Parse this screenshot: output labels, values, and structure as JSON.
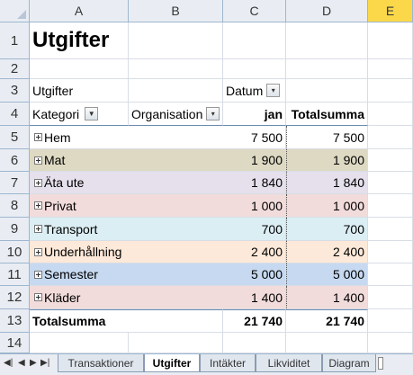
{
  "columns": [
    "A",
    "B",
    "C",
    "D",
    "E"
  ],
  "rows": [
    "1",
    "2",
    "3",
    "4",
    "5",
    "6",
    "7",
    "8",
    "9",
    "10",
    "11",
    "12",
    "13",
    "14"
  ],
  "title": "Utgifter",
  "pivot": {
    "filter_label": "Utgifter",
    "col_field": "Datum",
    "header_kategori": "Kategori",
    "header_org": "Organisation",
    "header_jan": "jan",
    "header_total": "Totalsumma",
    "items": [
      {
        "label": "Hem",
        "jan": "7 500",
        "total": "7 500",
        "color": "#ffffff"
      },
      {
        "label": "Mat",
        "jan": "1 900",
        "total": "1 900",
        "color": "#ddd9c3"
      },
      {
        "label": "Äta ute",
        "jan": "1 840",
        "total": "1 840",
        "color": "#e5e0ec"
      },
      {
        "label": "Privat",
        "jan": "1 000",
        "total": "1 000",
        "color": "#f2dcdb"
      },
      {
        "label": "Transport",
        "jan": "700",
        "total": "700",
        "color": "#dbeef3"
      },
      {
        "label": "Underhållning",
        "jan": "2 400",
        "total": "2 400",
        "color": "#fde9d9"
      },
      {
        "label": "Semester",
        "jan": "5 000",
        "total": "5 000",
        "color": "#c6d9f0"
      },
      {
        "label": "Kläder",
        "jan": "1 400",
        "total": "1 400",
        "color": "#f2dcdb"
      }
    ],
    "grand_label": "Totalsumma",
    "grand_jan": "21 740",
    "grand_total": "21 740"
  },
  "tabs": [
    "Transaktioner",
    "Utgifter",
    "Intäkter",
    "Likviditet",
    "Diagram"
  ],
  "active_tab": "Utgifter"
}
